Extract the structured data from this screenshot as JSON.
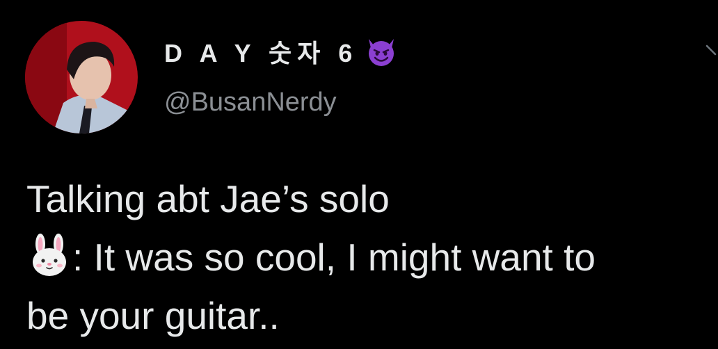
{
  "tweet": {
    "display_name": "D A Y 숫자 6",
    "handle": "@BusanNerdy",
    "lines": {
      "line1": "Talking abt Jae’s solo",
      "line2": ": It was so cool, I might want to",
      "line3": "be your guitar.."
    }
  },
  "icons": {
    "name_emoji": "smiling-devil-icon",
    "line_emoji": "rabbit-face-icon",
    "menu": "chevron-down-icon"
  },
  "colors": {
    "background": "#000000",
    "text": "#e7e9ea",
    "secondary_text": "#8b8f94",
    "avatar_bg": "#b0101c",
    "devil": "#8b3fd1"
  }
}
